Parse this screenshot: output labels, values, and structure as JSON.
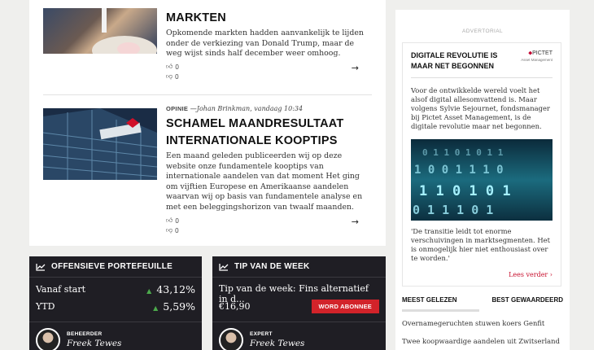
{
  "articles": [
    {
      "title": "MARKTEN",
      "body": "Opkomende markten hadden aanvankelijk te lijden onder de verkiezing van Donald Trump, maar de weg wijst sinds half december weer omhoog.",
      "likes": "0",
      "dislikes": "0"
    },
    {
      "category": "OPINIE",
      "byline": "—Johan Brinkman, vandaag 10:34",
      "title_line1": "SCHAMEL MAANDRESULTAAT",
      "title_line2": "INTERNATIONALE KOOPTIPS",
      "body": "Een maand geleden publiceerden wij op deze website onze fundamentele kooptips van internationale aandelen van dat moment Het ging om vijftien Europese en Amerikaanse aandelen waarvan wij op basis van fundamentele analyse en met een beleggingshorizon van twaalf maanden.",
      "likes": "0",
      "dislikes": "0"
    }
  ],
  "widgets": {
    "portfolio": {
      "title": "OFFENSIEVE PORTEFEUILLE",
      "rows": [
        {
          "label": "Vanaf start",
          "value": "43,12%"
        },
        {
          "label": "YTD",
          "value": "5,59%"
        }
      ],
      "role": "BEHEERDER",
      "person": "Freek Tewes"
    },
    "tip": {
      "title": "TIP VAN DE WEEK",
      "headline": "Tip van de week: Fins alternatief in d...",
      "price": "€16,90",
      "button": "WORD ABONNEE",
      "role": "EXPERT",
      "person": "Freek Tewes"
    }
  },
  "sidebar": {
    "label": "ADVERTORIAL",
    "ad": {
      "title": "DIGITALE REVOLUTIE IS MAAR NET BEGONNEN",
      "logo": "PICTET",
      "logo_sub": "Asset Management",
      "text": "Voor de ontwikkelde wereld voelt het alsof digital allesomvattend is. Maar volgens Sylvie Sejournet, fondsmanager bij Pictet Asset Management, is de digitale revolutie maar net begonnen.",
      "quote": "'De transitie leidt tot enorme verschuivingen in marktsegmenten. Het is onmogelijk hier niet enthousiast over te worden.'",
      "more": "Lees verder ›"
    },
    "tabs": [
      "MEEST GELEZEN",
      "BEST GEWAARDEERD"
    ],
    "items": [
      "Overnamegeruchten stuwen koers Genfit",
      "Twee koopwaardige aandelen uit Zwitserland"
    ]
  },
  "colors": {
    "accent_red": "#d2232a",
    "widget_bg": "#1f1e24",
    "up_green": "#4caa4c"
  }
}
